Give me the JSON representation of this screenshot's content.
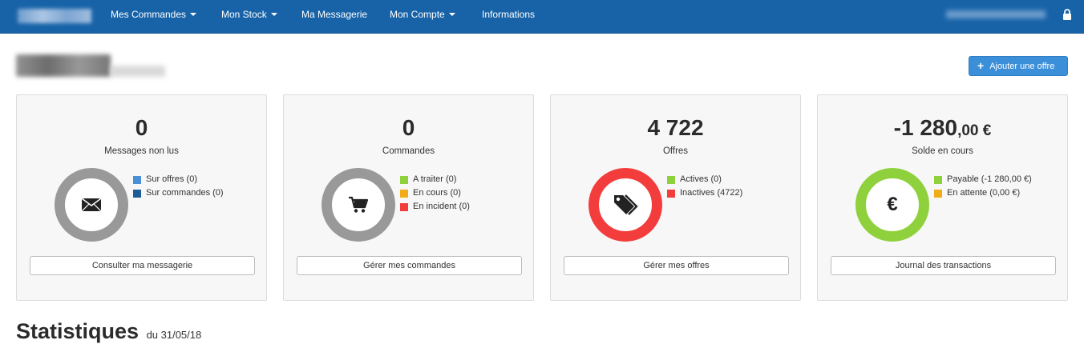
{
  "nav": {
    "items": [
      {
        "label": "Mes Commandes",
        "dropdown": true
      },
      {
        "label": "Mon Stock",
        "dropdown": true
      },
      {
        "label": "Ma Messagerie",
        "dropdown": false
      },
      {
        "label": "Mon Compte",
        "dropdown": true
      },
      {
        "label": "Informations",
        "dropdown": false
      }
    ]
  },
  "header": {
    "add_offer_label": "Ajouter une offre"
  },
  "cards": [
    {
      "value": "0",
      "cents": "",
      "label": "Messages non lus",
      "icon": "envelope-icon",
      "ring_color": "#999999",
      "legend": [
        {
          "label": "Sur offres (0)",
          "color": "#4a90d9"
        },
        {
          "label": "Sur commandes (0)",
          "color": "#1f5d99"
        }
      ],
      "button": "Consulter ma messagerie"
    },
    {
      "value": "0",
      "cents": "",
      "label": "Commandes",
      "icon": "cart-icon",
      "ring_color": "#999999",
      "legend": [
        {
          "label": "A traiter (0)",
          "color": "#8fd13c"
        },
        {
          "label": "En cours (0)",
          "color": "#f0ad17"
        },
        {
          "label": "En incident (0)",
          "color": "#f33c3c"
        }
      ],
      "button": "Gérer mes commandes"
    },
    {
      "value": "4 722",
      "cents": "",
      "label": "Offres",
      "icon": "tags-icon",
      "ring_color": "#f33c3c",
      "legend": [
        {
          "label": "Actives (0)",
          "color": "#8fd13c"
        },
        {
          "label": "Inactives (4722)",
          "color": "#f33c3c"
        }
      ],
      "button": "Gérer mes offres"
    },
    {
      "value": "-1 280",
      "cents": ",00 €",
      "label": "Solde en cours",
      "icon": "euro-icon",
      "icon_text": "€",
      "ring_color": "#8fd13c",
      "legend": [
        {
          "label": "Payable (-1 280,00 €)",
          "color": "#8fd13c"
        },
        {
          "label": "En attente (0,00 €)",
          "color": "#f0ad17"
        }
      ],
      "button": "Journal des transactions"
    }
  ],
  "stats": {
    "title": "Statistiques",
    "date": "du 31/05/18"
  }
}
